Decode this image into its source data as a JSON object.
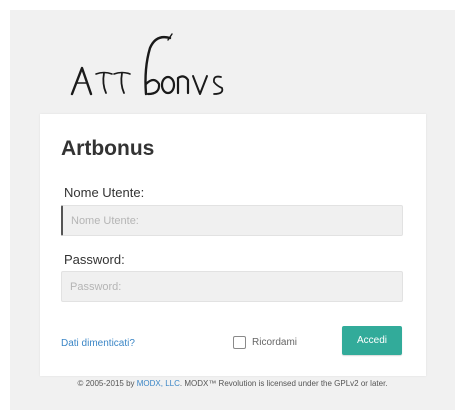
{
  "logo": {
    "text": "Artbonus"
  },
  "login": {
    "title": "Artbonus",
    "username_label": "Nome Utente:",
    "username_placeholder": "Nome Utente:",
    "password_label": "Password:",
    "password_placeholder": "Password:",
    "forgot_link": "Dati dimenticati?",
    "remember_label": "Ricordami",
    "remember_checked": false,
    "submit_label": "Accedi"
  },
  "footer": {
    "prefix": "© 2005-2015 by ",
    "company_link": "MODX, LLC",
    "suffix": ". MODX™ Revolution is licensed under the GPLv2 or later."
  },
  "colors": {
    "accent": "#32ab9a",
    "link": "#3b86c6",
    "background": "#f1f1f1"
  }
}
